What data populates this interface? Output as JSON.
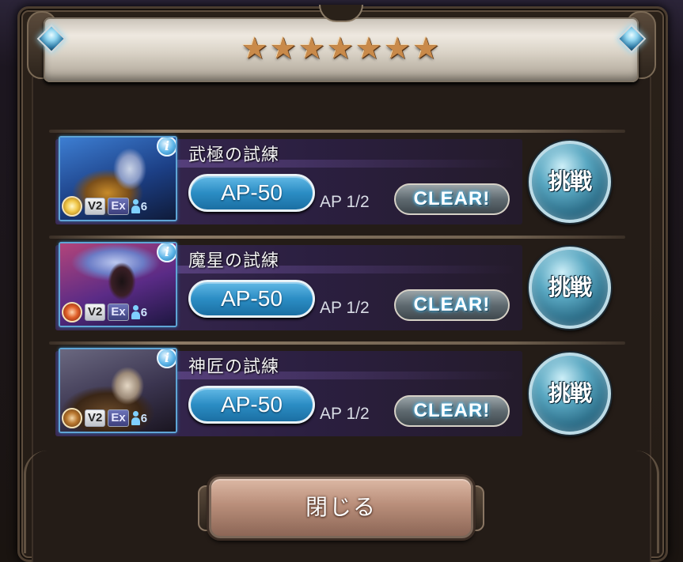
{
  "rating": {
    "stars": 7,
    "star_glyph": "★",
    "star_color": "#c98a4a"
  },
  "quests": [
    {
      "title": "武極の試練",
      "portrait": "character-portrait-blue-armor",
      "element": "light",
      "tags": [
        "V2",
        "Ex"
      ],
      "members": "6",
      "ap_cost": "AP-50",
      "ap_count": "AP 1/2",
      "status": "CLEAR!",
      "challenge_label": "挑戦",
      "info_label": "i"
    },
    {
      "title": "魔星の試練",
      "portrait": "character-portrait-purple-mage",
      "element": "fire",
      "tags": [
        "V2",
        "Ex"
      ],
      "members": "6",
      "ap_cost": "AP-50",
      "ap_count": "AP 1/2",
      "status": "CLEAR!",
      "challenge_label": "挑戦",
      "info_label": "i"
    },
    {
      "title": "神匠の試練",
      "portrait": "character-portrait-armored-smith",
      "element": "earth",
      "tags": [
        "V2",
        "Ex"
      ],
      "members": "6",
      "ap_cost": "AP-50",
      "ap_count": "AP 1/2",
      "status": "CLEAR!",
      "challenge_label": "挑戦",
      "info_label": "i"
    }
  ],
  "close_label": "閉じる",
  "colors": {
    "ap_button": "#2b8dc4",
    "challenge_button": "#22617c",
    "close_button": "#b98e7a",
    "clear_glow": "#2ca6e0"
  }
}
